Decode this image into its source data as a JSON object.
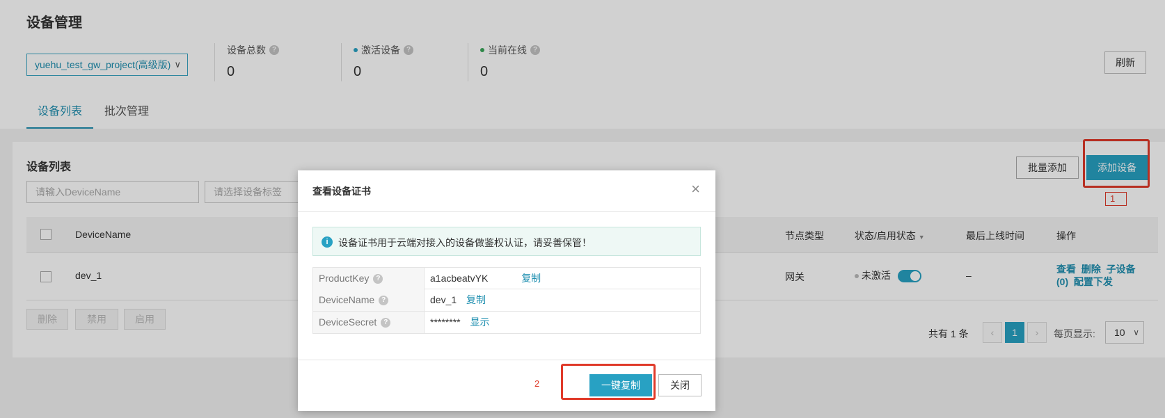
{
  "page": {
    "title": "设备管理",
    "project_select": "yuehu_test_gw_project(高级版)",
    "refresh_label": "刷新"
  },
  "stats": [
    {
      "label": "设备总数",
      "value": "0"
    },
    {
      "label": "激活设备",
      "value": "0",
      "dot_color": "#28a1c3"
    },
    {
      "label": "当前在线",
      "value": "0",
      "dot_color": "#3aa65a"
    }
  ],
  "tabs": [
    "设备列表",
    "批次管理"
  ],
  "device_panel": {
    "title": "设备列表",
    "name_placeholder": "请输入DeviceName",
    "tag_placeholder": "请选择设备标签",
    "batch_add_label": "批量添加",
    "add_device_label": "添加设备",
    "columns": {
      "device_name": "DeviceName",
      "node_type": "节点类型",
      "status": "状态/启用状态",
      "last_online": "最后上线时间",
      "actions": "操作"
    },
    "row": {
      "device_name": "dev_1",
      "node_type": "网关",
      "status": "未激活",
      "last_online": "–",
      "actions": {
        "view": "查看",
        "delete": "删除",
        "sub_device": "子设备",
        "sub_count": "(0)",
        "config": "配置下发"
      }
    },
    "bulk_buttons": [
      "删除",
      "禁用",
      "启用"
    ],
    "pagination": {
      "total_text": "共有 1 条",
      "prev": "‹",
      "current": "1",
      "next": "›",
      "per_page_label": "每页显示:",
      "per_page_value": "10"
    }
  },
  "modal": {
    "title": "查看设备证书",
    "info": "设备证书用于云端对接入的设备做鉴权认证，请妥善保管！",
    "fields": [
      {
        "key": "ProductKey",
        "value": "a1acbeatvYK",
        "action": "复制"
      },
      {
        "key": "DeviceName",
        "value": "dev_1",
        "action": "复制"
      },
      {
        "key": "DeviceSecret",
        "value": "********",
        "action": "显示"
      }
    ],
    "copy_all_label": "一键复制",
    "close_label": "关闭"
  },
  "annotations": {
    "step1": "1",
    "step2": "2",
    "color": "#e03a2a"
  },
  "colors": {
    "accent": "#28a1c3",
    "link": "#1f8fb0"
  }
}
